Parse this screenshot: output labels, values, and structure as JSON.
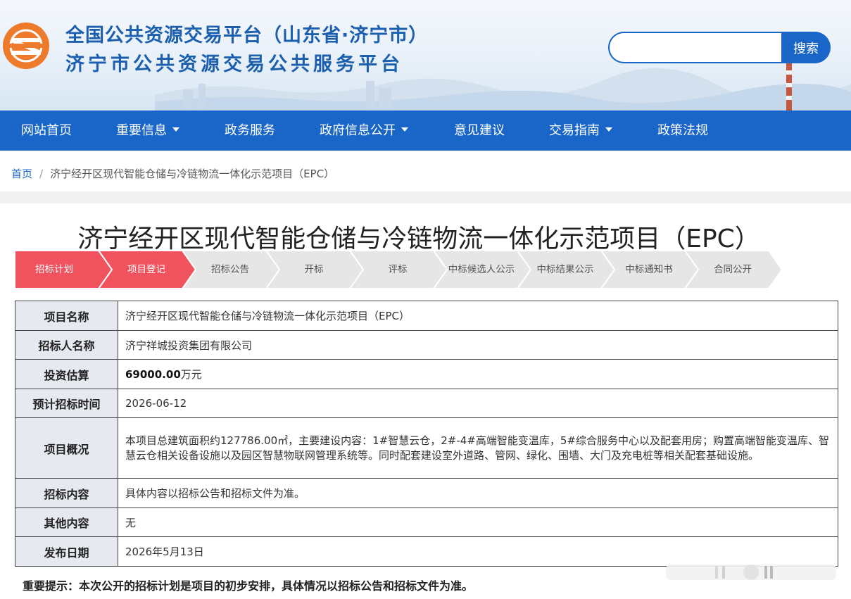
{
  "header": {
    "title_line1": "全国公共资源交易平台（山东省·济宁市）",
    "title_line2": "济宁市公共资源交易公共服务平台",
    "search_placeholder": "",
    "search_button": "搜索"
  },
  "nav": {
    "items": [
      {
        "label": "网站首页",
        "dropdown": false
      },
      {
        "label": "重要信息",
        "dropdown": true
      },
      {
        "label": "政务服务",
        "dropdown": false
      },
      {
        "label": "政府信息公开",
        "dropdown": true
      },
      {
        "label": "意见建议",
        "dropdown": false
      },
      {
        "label": "交易指南",
        "dropdown": true
      },
      {
        "label": "政策法规",
        "dropdown": false
      }
    ]
  },
  "breadcrumb": {
    "home": "首页",
    "separator": "/",
    "current": "济宁经开区现代智能仓储与冷链物流一体化示范项目（EPC）"
  },
  "page_title": "济宁经开区现代智能仓储与冷链物流一体化示范项目（EPC）",
  "steps": [
    {
      "label": "招标计划",
      "state": "active"
    },
    {
      "label": "项目登记",
      "state": "active"
    },
    {
      "label": "招标公告",
      "state": "inactive"
    },
    {
      "label": "开标",
      "state": "inactive"
    },
    {
      "label": "评标",
      "state": "inactive"
    },
    {
      "label": "中标候选人公示",
      "state": "inactive"
    },
    {
      "label": "中标结果公示",
      "state": "inactive"
    },
    {
      "label": "中标通知书",
      "state": "inactive"
    },
    {
      "label": "合同公开",
      "state": "inactive"
    }
  ],
  "table": {
    "project_name": {
      "label": "项目名称",
      "value": "济宁经开区现代智能仓储与冷链物流一体化示范项目（EPC）"
    },
    "tenderer": {
      "label": "招标人名称",
      "value": "济宁祥城投资集团有限公司"
    },
    "investment": {
      "label": "投资估算",
      "amount": "69000.00",
      "unit": "万元"
    },
    "planned_time": {
      "label": "预计招标时间",
      "value": "2026-06-12"
    },
    "overview": {
      "label": "项目概况",
      "value": "本项目总建筑面积约127786.00㎡，主要建设内容：1#智慧云仓，2#-4#高端智能变温库，5#综合服务中心以及配套用房；购置高端智能变温库、智慧云仓相关设备设施以及园区智慧物联网管理系统等。同时配套建设室外道路、管网、绿化、围墙、大门及充电桩等相关配套基础设施。"
    },
    "content": {
      "label": "招标内容",
      "value": "具体内容以招标公告和招标文件为准。"
    },
    "other": {
      "label": "其他内容",
      "value": "无"
    },
    "publish_date": {
      "label": "发布日期",
      "value": "2026年5月13日"
    }
  },
  "notice": "重要提示：本次公开的招标计划是项目的初步安排，具体情况以招标公告和招标文件为准。",
  "colors": {
    "brand_blue": "#1a66c8",
    "step_active": "#f0525e",
    "step_inactive": "#e6e6e6",
    "label_bg": "#e6e9ef",
    "logo_orange": "#ee7a2c"
  }
}
